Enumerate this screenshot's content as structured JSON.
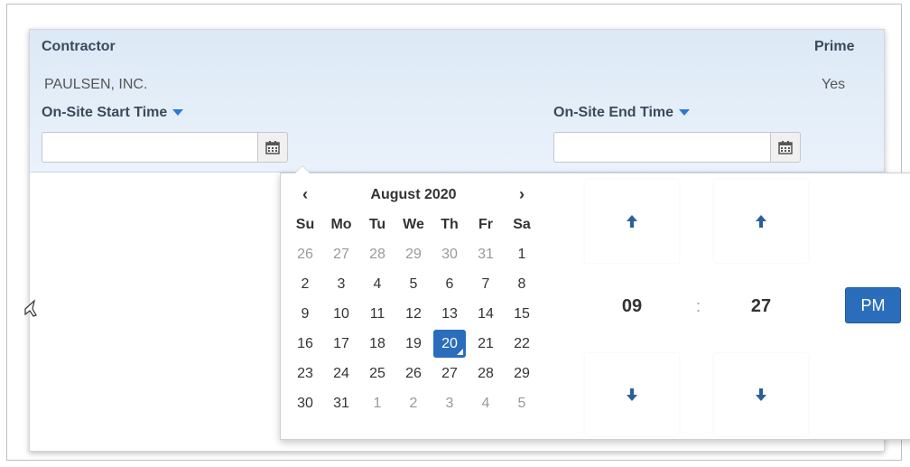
{
  "header": {
    "contractor_label": "Contractor",
    "contractor_value": "PAULSEN, INC.",
    "prime_label": "Prime",
    "prime_value": "Yes",
    "start_time_label": "On-Site Start Time",
    "end_time_label": "On-Site End Time",
    "start_time_value": "",
    "end_time_value": ""
  },
  "calendar": {
    "month_title": "August 2020",
    "prev": "‹",
    "next": "›",
    "weekdays": [
      "Su",
      "Mo",
      "Tu",
      "We",
      "Th",
      "Fr",
      "Sa"
    ],
    "weeks": [
      [
        {
          "d": "26",
          "old": true
        },
        {
          "d": "27",
          "old": true
        },
        {
          "d": "28",
          "old": true
        },
        {
          "d": "29",
          "old": true
        },
        {
          "d": "30",
          "old": true
        },
        {
          "d": "31",
          "old": true
        },
        {
          "d": "1"
        }
      ],
      [
        {
          "d": "2"
        },
        {
          "d": "3"
        },
        {
          "d": "4"
        },
        {
          "d": "5"
        },
        {
          "d": "6"
        },
        {
          "d": "7"
        },
        {
          "d": "8"
        }
      ],
      [
        {
          "d": "9"
        },
        {
          "d": "10"
        },
        {
          "d": "11"
        },
        {
          "d": "12"
        },
        {
          "d": "13"
        },
        {
          "d": "14"
        },
        {
          "d": "15"
        }
      ],
      [
        {
          "d": "16"
        },
        {
          "d": "17"
        },
        {
          "d": "18"
        },
        {
          "d": "19"
        },
        {
          "d": "20",
          "active": true
        },
        {
          "d": "21"
        },
        {
          "d": "22"
        }
      ],
      [
        {
          "d": "23"
        },
        {
          "d": "24"
        },
        {
          "d": "25"
        },
        {
          "d": "26"
        },
        {
          "d": "27"
        },
        {
          "d": "28"
        },
        {
          "d": "29"
        }
      ],
      [
        {
          "d": "30"
        },
        {
          "d": "31"
        },
        {
          "d": "1",
          "old": true
        },
        {
          "d": "2",
          "old": true
        },
        {
          "d": "3",
          "old": true
        },
        {
          "d": "4",
          "old": true
        },
        {
          "d": "5",
          "old": true
        }
      ]
    ]
  },
  "time": {
    "hour": "09",
    "separator": ":",
    "minute": "27",
    "meridiem": "PM"
  },
  "icons": {
    "calendar": "calendar-icon",
    "arrow_up": "arrow-up-icon",
    "arrow_down": "arrow-down-icon",
    "caret": "caret-down-icon"
  },
  "colors": {
    "accent": "#2a6ebb",
    "header_bg": "#dce9f6"
  }
}
